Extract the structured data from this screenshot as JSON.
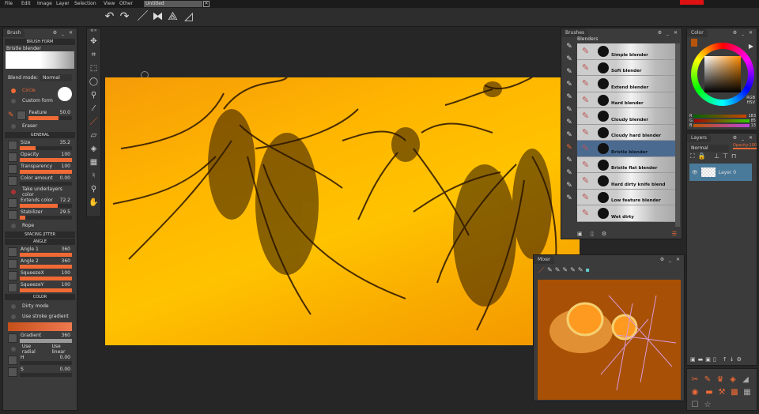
{
  "menu": [
    "File",
    "Edit",
    "Image",
    "Layer",
    "Selection",
    "View",
    "Other"
  ],
  "document": {
    "title": "Untitled",
    "close": "✕"
  },
  "toolbar": [
    {
      "icon": "undo-icon",
      "g": "↶"
    },
    {
      "icon": "redo-icon",
      "g": "↷"
    },
    {
      "icon": "brush-icon",
      "g": "／"
    },
    {
      "icon": "symmetry-icon",
      "g": "⧓"
    },
    {
      "icon": "perspective-icon",
      "g": "⟁"
    },
    {
      "icon": "ruler-icon",
      "g": "◿"
    }
  ],
  "brush_panel": {
    "tab": "Brush",
    "controls": "⚙ _ ✕",
    "section_form": "BRUSH FORM",
    "brush_name": "Bristle blender",
    "blend_label": "Blend mode:",
    "blend_value": "Normal",
    "circle": "Circle",
    "custom_form": "Custom form",
    "feature": {
      "label": "Feature",
      "value": "50.0",
      "fill": 0.5
    },
    "eraser": "Eraser",
    "section_general": "GENERAL",
    "general": [
      {
        "label": "Size",
        "value": "35.2",
        "fill": 0.3
      },
      {
        "label": "Opacity",
        "value": "100",
        "fill": 1
      },
      {
        "label": "Transparency",
        "value": "100",
        "fill": 1
      },
      {
        "label": "Color amount",
        "value": "0.00",
        "fill": 0
      }
    ],
    "take_under": "Take underlayers color",
    "general2": [
      {
        "label": "Extends color",
        "value": "72.2",
        "fill": 0.72
      },
      {
        "label": "Stabilizer",
        "value": "29.5",
        "fill": 0.1
      }
    ],
    "rope": "Rope",
    "section_spacing": "SPACING JITTER",
    "section_angle": "ANGLE",
    "angle": [
      {
        "label": "Angle 1",
        "value": "360",
        "fill": 1
      },
      {
        "label": "Angle 2",
        "value": "360",
        "fill": 1
      },
      {
        "label": "SqueezeX",
        "value": "100",
        "fill": 1
      },
      {
        "label": "SqueezeY",
        "value": "100",
        "fill": 1
      }
    ],
    "section_color": "COLOR",
    "dirty_mode": "Dirty mode",
    "stroke_gradient": "Use stroke gradient",
    "gradient": {
      "label": "Gradient",
      "value": "360",
      "fill": 1
    },
    "use_radial": "Use radial",
    "use_linear": "Use linear",
    "hsv": [
      {
        "label": "H",
        "value": "0.00",
        "fill": 0
      },
      {
        "label": "S",
        "value": "0.00",
        "fill": 0
      }
    ]
  },
  "brushes_panel": {
    "tab": "Brushes",
    "controls": "⚙ _ ✕",
    "category": "Blenders",
    "items": [
      "Simple blender",
      "Soft blender",
      "Extend blender",
      "Hard blender",
      "Cloudy blender",
      "Cloudy hard blender",
      "Bristle blender",
      "Bristle flat blender",
      "Hard dirty knife blend",
      "Low feature blender",
      "Wet dirty"
    ],
    "selected": "Bristle blender"
  },
  "mixer": {
    "tab": "Mixer",
    "controls": "⚙ _ ✕"
  },
  "color_panel": {
    "tab": "Color",
    "controls": "⚙ _ ✕",
    "mode1": "RGB",
    "mode2": "HSV",
    "rgb": [
      {
        "ch": "R",
        "value": "183"
      },
      {
        "ch": "G",
        "value": "85"
      },
      {
        "ch": "B",
        "value": "13"
      }
    ],
    "current": "#b7550d"
  },
  "layers_panel": {
    "tab": "Layers",
    "controls": "⚙ _ ✕",
    "blend": "Normal",
    "opacity_label": "Opacity:100",
    "layer": "Layer 0"
  },
  "colors": {
    "accent": "#f06a35",
    "canvas_bg": "#262626",
    "panel": "#3b3b3b"
  }
}
